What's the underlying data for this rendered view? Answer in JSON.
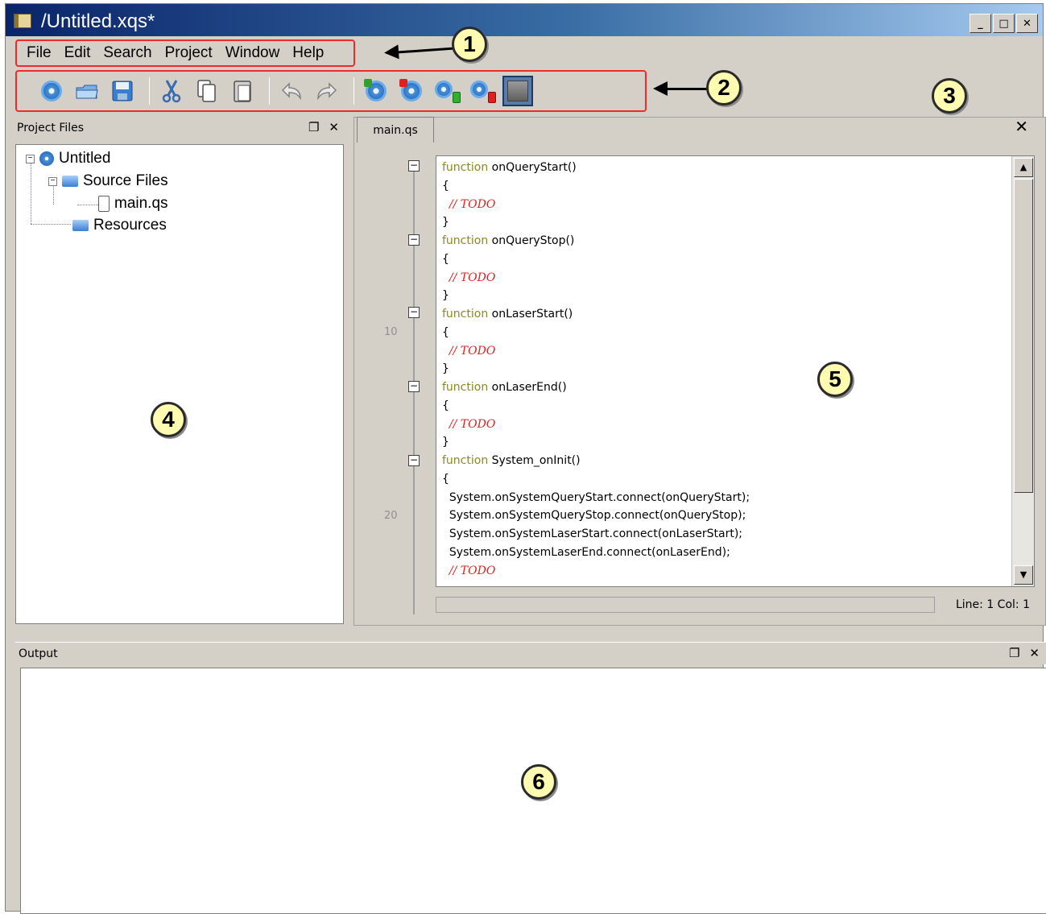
{
  "window": {
    "title": "/Untitled.xqs*",
    "controls": [
      "_",
      "□",
      "✕"
    ]
  },
  "menu": {
    "items": [
      "File",
      "Edit",
      "Search",
      "Project",
      "Window",
      "Help"
    ]
  },
  "annotations": [
    "1",
    "2",
    "3",
    "4",
    "5",
    "6"
  ],
  "toolbar": {
    "icons": [
      "new-project-icon",
      "open-icon",
      "save-icon",
      "cut-icon",
      "copy-icon",
      "paste-icon",
      "undo-icon",
      "redo-icon",
      "start-icon",
      "stop-icon",
      "run-green-icon",
      "run-red-icon",
      "device-icon"
    ]
  },
  "project_panel": {
    "title": "Project Files",
    "tree": {
      "root": "Untitled",
      "source_folder": "Source Files",
      "file": "main.qs",
      "resources": "Resources"
    }
  },
  "editor": {
    "tab_label": "main.qs",
    "close_label": "✕",
    "line_numbers": [
      "10",
      "20"
    ],
    "code": [
      {
        "kw": "function",
        "rest": " onQueryStart()"
      },
      {
        "plain": "{"
      },
      {
        "comment": "  // TODO"
      },
      {
        "plain": "}"
      },
      {
        "kw": "function",
        "rest": " onQueryStop()"
      },
      {
        "plain": "{"
      },
      {
        "comment": "  // TODO"
      },
      {
        "plain": "}"
      },
      {
        "kw": "function",
        "rest": " onLaserStart()"
      },
      {
        "plain": "{"
      },
      {
        "comment": "  // TODO"
      },
      {
        "plain": "}"
      },
      {
        "kw": "function",
        "rest": " onLaserEnd()"
      },
      {
        "plain": "{"
      },
      {
        "comment": "  // TODO"
      },
      {
        "plain": "}"
      },
      {
        "kw": "function",
        "rest": " System_onInit()"
      },
      {
        "plain": "{"
      },
      {
        "plain": "  System.onSystemQueryStart.connect(onQueryStart);"
      },
      {
        "plain": "  System.onSystemQueryStop.connect(onQueryStop);"
      },
      {
        "plain": "  System.onSystemLaserStart.connect(onLaserStart);"
      },
      {
        "plain": "  System.onSystemLaserEnd.connect(onLaserEnd);"
      },
      {
        "comment": "  // TODO"
      }
    ],
    "status": "Line: 1 Col: 1"
  },
  "output_panel": {
    "title": "Output"
  },
  "colors": {
    "annotation_border": "#ee2b2b",
    "keyword": "#8a8a20",
    "comment": "#e02020",
    "badge_fill": "#fffbb0"
  }
}
